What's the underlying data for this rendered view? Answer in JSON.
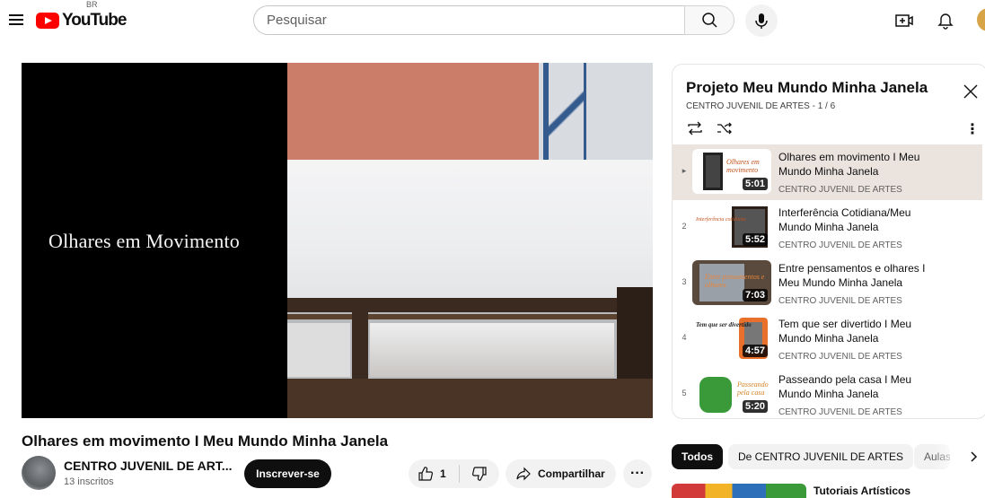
{
  "header": {
    "logo_text": "YouTube",
    "country_code": "BR",
    "search_placeholder": "Pesquisar"
  },
  "player": {
    "overlay_text": "Olhares em Movimento"
  },
  "video": {
    "title": "Olhares em movimento I Meu Mundo Minha Janela",
    "channel_name": "CENTRO JUVENIL DE ART...",
    "subscribers": "13 inscritos",
    "subscribe_label": "Inscrever-se",
    "like_count": "1",
    "share_label": "Compartilhar",
    "more_label": "···"
  },
  "playlist": {
    "title": "Projeto Meu Mundo Minha Janela",
    "subtitle": "CENTRO JUVENIL DE ARTES - 1 / 6",
    "items": [
      {
        "index": "▸",
        "title": "Olhares em movimento I Meu Mundo Minha Janela",
        "channel": "CENTRO JUVENIL DE ARTES",
        "duration": "5:01",
        "active": true
      },
      {
        "index": "2",
        "title": "Interferência Cotidiana/Meu Mundo Minha Janela",
        "channel": "CENTRO JUVENIL DE ARTES",
        "duration": "5:52",
        "active": false
      },
      {
        "index": "3",
        "title": "Entre pensamentos e olhares I Meu Mundo Minha Janela",
        "channel": "CENTRO JUVENIL DE ARTES",
        "duration": "7:03",
        "active": false
      },
      {
        "index": "4",
        "title": "Tem que ser divertido I Meu Mundo Minha Janela",
        "channel": "CENTRO JUVENIL DE ARTES",
        "duration": "4:57",
        "active": false
      },
      {
        "index": "5",
        "title": "Passeando pela casa I Meu Mundo Minha Janela",
        "channel": "CENTRO JUVENIL DE ARTES",
        "duration": "5:20",
        "active": false
      }
    ],
    "thumb_text": {
      "a": "Olhares em movimento",
      "b": "Interferência cotidiana",
      "c": "Entre pensamentos e olhares",
      "d": "Tem que ser divertido",
      "e": "Passeando pela casa"
    }
  },
  "chips": [
    "Todos",
    "De CENTRO JUVENIL DE ARTES",
    "Aulas"
  ],
  "recommendation": {
    "title": "Tutoriais Artísticos"
  },
  "colors": {
    "brand_red": "#ff0000",
    "active_row": "#ebe3de",
    "subscribe_bg": "#0f0f0f"
  }
}
